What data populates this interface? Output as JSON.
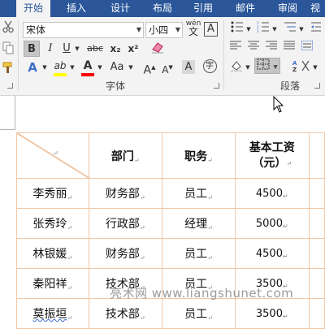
{
  "tabs": [
    {
      "label": "开始",
      "active": true
    },
    {
      "label": "插入"
    },
    {
      "label": "设计"
    },
    {
      "label": "布局"
    },
    {
      "label": "引用"
    },
    {
      "label": "邮件"
    },
    {
      "label": "审阅"
    },
    {
      "label": "视"
    }
  ],
  "font_group": {
    "font_name": "宋体",
    "font_size": "小四",
    "label": "字体",
    "wen": "wén",
    "wen_char": "文",
    "A_box": "A",
    "bold": "B",
    "italic": "I",
    "underline": "U",
    "strike": "abc",
    "sub": "x₂",
    "sup": "x²",
    "grow": "A",
    "shrink": "A",
    "case": "Aa",
    "enclose": "字",
    "font_color": "A",
    "highlight": "ab"
  },
  "paragraph_group": {
    "label": "段落"
  },
  "colors": {
    "ribbon_tab": "#2b579a",
    "table_border": "#f1c6a5",
    "highlight": "#ffff00",
    "font_color": "#ff0000",
    "a_blue": "#3e6fc7"
  },
  "table": {
    "headers": [
      "部门",
      "职务",
      "基本工资"
    ],
    "header_unit": "（元）",
    "rows": [
      [
        "李秀丽",
        "财务部",
        "员工",
        "4500"
      ],
      [
        "张秀玲",
        "行政部",
        "经理",
        "5000"
      ],
      [
        "林银媛",
        "财务部",
        "员工",
        "4500"
      ],
      [
        "秦阳祥",
        "技术部",
        "员工",
        "3500"
      ],
      [
        "莫振垣",
        "技术部",
        "员工",
        "3500"
      ]
    ]
  },
  "watermark": "亮术网 www.liangshunet.com"
}
